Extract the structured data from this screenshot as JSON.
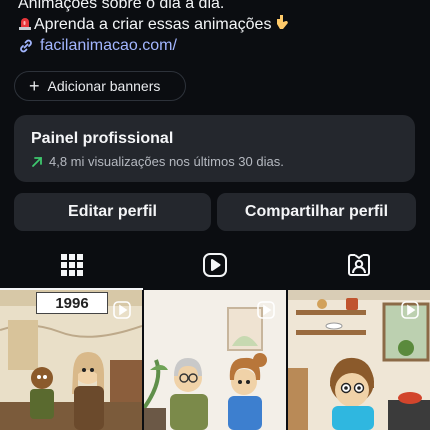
{
  "bio": {
    "line1": "Animações sobre o dia a dia.",
    "line2": "Aprenda a criar essas animações",
    "line2_emoji_start": "siren-icon",
    "line2_emoji_end": "pointing-down-icon",
    "link": "facilanimacao.com/"
  },
  "add_banners": {
    "label": "Adicionar banners",
    "icon": "plus-icon"
  },
  "pro_panel": {
    "title": "Painel profissional",
    "subtitle": "4,8 mi visualizações nos últimos 30 dias.",
    "icon": "trend-up-icon",
    "accent": "#3ec76d"
  },
  "actions": {
    "edit": "Editar perfil",
    "share": "Compartilhar perfil"
  },
  "tabs": [
    {
      "icon": "grid-icon",
      "selected": true
    },
    {
      "icon": "reels-icon",
      "selected": false
    },
    {
      "icon": "tagged-icon",
      "selected": false
    }
  ],
  "posts": [
    {
      "label": "1996",
      "icon": "reel-badge-icon"
    },
    {
      "icon": "reel-badge-icon"
    },
    {
      "icon": "reel-badge-icon"
    }
  ],
  "colors": {
    "background": "#0b0d11",
    "surface": "#24272d",
    "link": "#a3b6ff"
  }
}
